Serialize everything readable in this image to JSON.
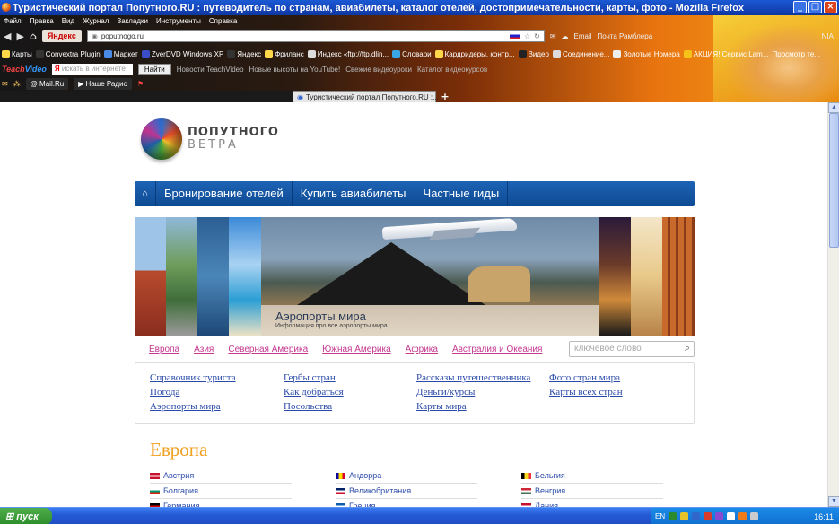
{
  "window": {
    "title": "Туристический портал Попутного.RU : путеводитель по странам, авиабилеты, каталог отелей, достопримечательности, карты, фото - Mozilla Firefox"
  },
  "menu": [
    "Файл",
    "Правка",
    "Вид",
    "Журнал",
    "Закладки",
    "Инструменты",
    "Справка"
  ],
  "navbar": {
    "yandex": "Яндекс",
    "url": "poputnogo.ru",
    "email": "Email",
    "mail_label": "Почта Рамблера",
    "user": "NIA"
  },
  "bookmarks": [
    "Карты",
    "Convextra Plugin",
    "Маркет",
    "ZverDVD Windows XP",
    "Яндекс",
    "Фриланс",
    "Индекс «ftp://ftp.dlin...",
    "Словари",
    "Кардридеры, контр...",
    "Видео",
    "Соединение...",
    "Золотые Номера",
    "АКЦИЯ! Сервис Lam...",
    "Просмотр те..."
  ],
  "teachvideo": {
    "brand_a": "Teach",
    "brand_b": "Video",
    "search_placeholder": "искать в интернете",
    "find_button": "Найти",
    "news": "Новости TeachVideo",
    "new_heights": "Новые высоты на YouTube!",
    "fresh": "Свежие видеоуроки",
    "catalog": "Каталог видеокурсов"
  },
  "mailbar": {
    "mailru": "Mail.Ru",
    "radio": "Наше Радио"
  },
  "tab": {
    "label": "Туристический портал Попутного.RU :...",
    "new_tab": "+"
  },
  "site": {
    "logo_top": "ПОПУТНОГО",
    "logo_bottom": "ВЕТРА",
    "nav": [
      "Бронирование отелей",
      "Купить авиабилеты",
      "Частные гиды"
    ],
    "banner_title": "Аэропорты мира",
    "banner_sub": "Информация про все аэропорты мира",
    "continents": [
      "Европа",
      "Азия",
      "Северная Америка",
      "Южная Америка",
      "Африка",
      "Австралия и Океания"
    ],
    "search_placeholder": "ключевое слово",
    "links": [
      [
        "Справочник туриста",
        "Погода",
        "Аэропорты мира"
      ],
      [
        "Гербы стран",
        "Как добраться",
        "Посольства"
      ],
      [
        "Рассказы путешественника",
        "Деньги/курсы",
        "Карты мира"
      ],
      [
        "Фото стран мира",
        "Карты всех стран"
      ]
    ],
    "section_title": "Европа",
    "countries": [
      [
        {
          "name": "Австрия",
          "flag": [
            "#c8102e",
            "#fff",
            "#c8102e"
          ]
        },
        {
          "name": "Болгария",
          "flag": [
            "#fff",
            "#00966e",
            "#d62612"
          ]
        },
        {
          "name": "Германия",
          "flag": [
            "#000",
            "#dd0000",
            "#ffce00"
          ]
        }
      ],
      [
        {
          "name": "Андорра",
          "flag": [
            "#10069f",
            "#fedf00",
            "#d50032"
          ],
          "vertical": true
        },
        {
          "name": "Великобритания",
          "flag": [
            "#012169",
            "#fff",
            "#c8102e"
          ]
        },
        {
          "name": "Греция",
          "flag": [
            "#0d5eaf",
            "#fff",
            "#0d5eaf"
          ]
        }
      ],
      [
        {
          "name": "Бельгия",
          "flag": [
            "#000",
            "#fdda24",
            "#ef3340"
          ],
          "vertical": true
        },
        {
          "name": "Венгрия",
          "flag": [
            "#ce2939",
            "#fff",
            "#477050"
          ]
        },
        {
          "name": "Дания",
          "flag": [
            "#c8102e",
            "#fff",
            "#c8102e"
          ]
        }
      ]
    ]
  },
  "taskbar": {
    "start": "пуск",
    "lang": "EN",
    "time": "16:11"
  }
}
